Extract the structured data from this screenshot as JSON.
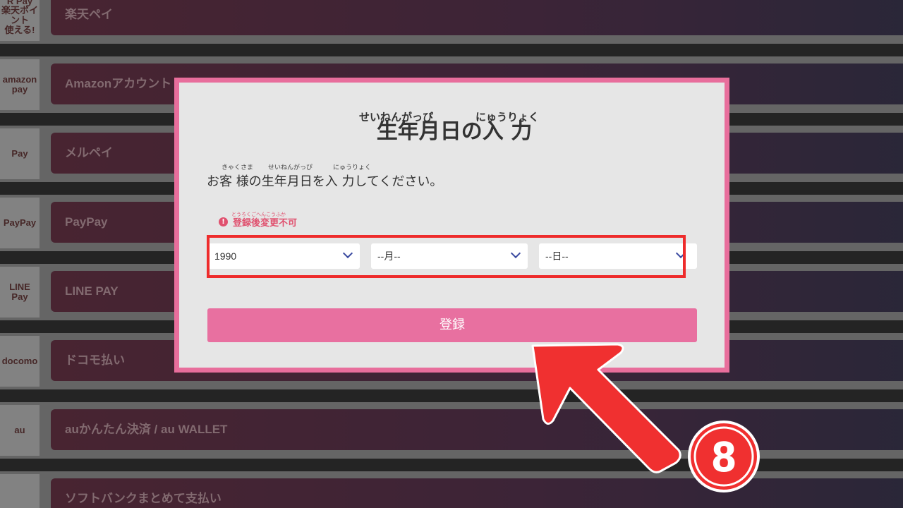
{
  "background_rows": [
    {
      "logo": "R Pay\n楽天ポイント\n使える!",
      "label": "楽天ペイ"
    },
    {
      "logo": "amazon\npay",
      "label": "Amazonアカウント"
    },
    {
      "logo": "Pay",
      "label": "メルペイ"
    },
    {
      "logo": "PayPay",
      "label": "PayPay"
    },
    {
      "logo": "LINE\nPay",
      "label": "LINE PAY"
    },
    {
      "logo": "docomo",
      "label": "ドコモ払い"
    },
    {
      "logo": "au",
      "label": "auかんたん決済 / au WALLET"
    },
    {
      "logo": "",
      "label": "ソフトバンクまとめて支払い"
    }
  ],
  "modal": {
    "title": "生年月日の入 力",
    "title_ruby_1": "せいねんがっぴ",
    "title_ruby_2": "にゅうりょく",
    "instruction": "お客 様の生年月日を入 力してください。",
    "instruction_ruby_1": "きゃくさま",
    "instruction_ruby_2": "せいねんがっぴ",
    "instruction_ruby_3": "にゅうりょく",
    "warning": "登録後変更不可",
    "warning_ruby": "とうろくごへんこうふか",
    "year_value": "1990",
    "month_value": "--月--",
    "day_value": "--日--",
    "submit_label": "登録"
  },
  "annotation": {
    "step_number": "8",
    "color": "#f03030"
  },
  "colors": {
    "accent_pink": "#e86e9c",
    "button_pink": "#e870a0",
    "warning_red": "#e0506e",
    "highlight_red": "#ee2c2c"
  }
}
